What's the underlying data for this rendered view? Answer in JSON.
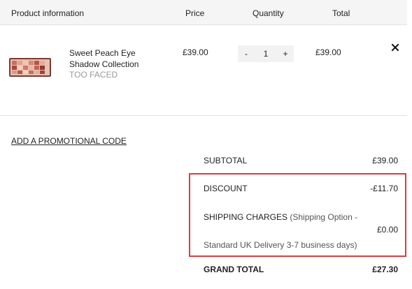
{
  "header": {
    "product": "Product information",
    "price": "Price",
    "quantity": "Quantity",
    "total": "Total"
  },
  "item": {
    "name_line1": "Sweet Peach Eye",
    "name_line2": "Shadow Collection",
    "brand": "TOO FACED",
    "price": "£39.00",
    "quantity": "1",
    "minus": "-",
    "plus": "+",
    "total": "£39.00",
    "thumbnail": "eyeshadow-palette-image",
    "remove_icon": "close-icon"
  },
  "promo": {
    "label": "ADD A PROMOTIONAL CODE"
  },
  "summary": {
    "subtotal_label": "SUBTOTAL",
    "subtotal_value": "£39.00",
    "discount_label": "DISCOUNT",
    "discount_value": "-£11.70",
    "shipping_label": "SHIPPING CHARGES",
    "shipping_option_a": "(Shipping Option -",
    "shipping_option_b": "Standard UK Delivery 3-7 business days)",
    "shipping_value": "£0.00",
    "grand_total_label": "GRAND TOTAL",
    "grand_total_value": "£27.30"
  },
  "colors": {
    "highlight": "#e03a3e",
    "header_bg": "#f5f5f5",
    "brand_text": "#999999"
  }
}
